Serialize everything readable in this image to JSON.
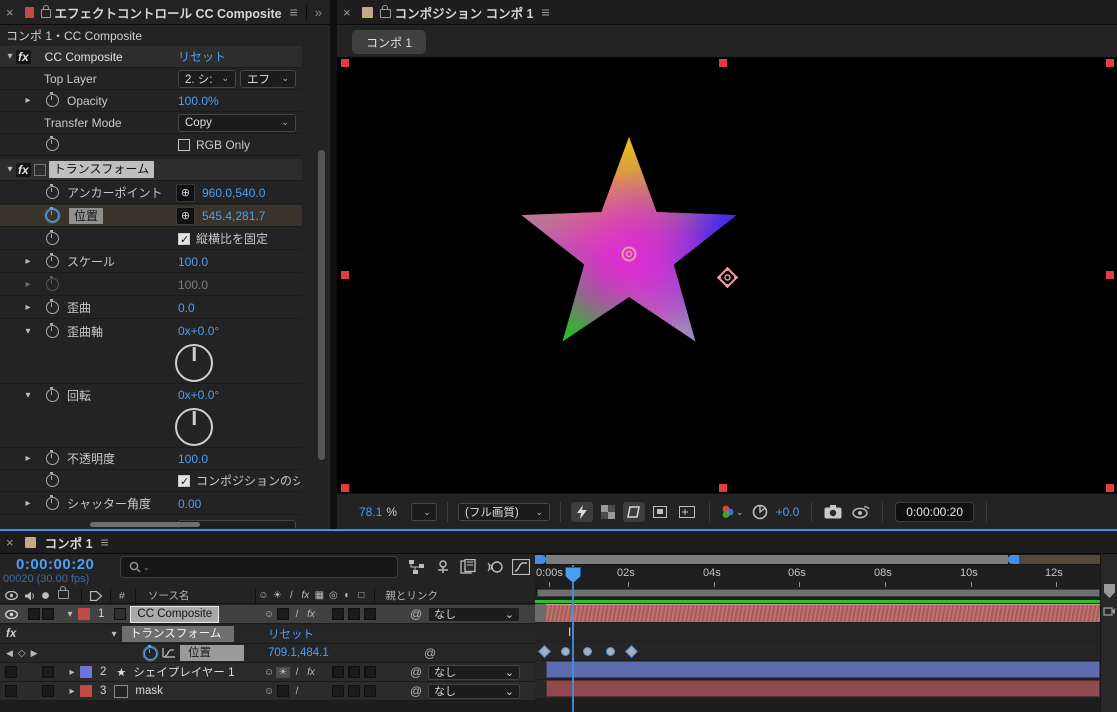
{
  "colors": {
    "accent_blue": "#4f9ef5",
    "tab_red": "#c14a44",
    "tab_tan": "#c2ab84",
    "label_red": "#c14a44",
    "label_blue": "#6e74d8",
    "bar_selected_red": "#bc6a66",
    "bar_blue": "#5d6cae",
    "bar_dark_red": "#8e4a4d",
    "cache_green": "#24c424",
    "playhead_blue": "#3f8fe8"
  },
  "icons": {
    "close": "×",
    "menu": "≡",
    "overflow": "»",
    "chevron_down": "▾",
    "chevron_right": "▸",
    "caret": "⌄",
    "star": "★",
    "pickwhip": "@",
    "target": "⊕",
    "kf_prev": "◀",
    "kf_add": "◇",
    "kf_next": "▶",
    "fx": "fx",
    "shy": "☺",
    "collapse": "☀",
    "quality": "/",
    "frame_blend": "▦",
    "motion_blur": "◎",
    "adjustment": "◐",
    "threed": "□",
    "hash": "#",
    "ibeam": "I"
  },
  "effect_controls": {
    "title": "エフェクトコントロール CC Composite",
    "breadcrumb": "コンポ 1・CC Composite",
    "reset": "リセット",
    "cc": {
      "name": "CC Composite",
      "top_layer_label": "Top Layer",
      "top_layer_value": "2. シ:",
      "top_layer_mode": "エフ",
      "opacity_label": "Opacity",
      "opacity_value": "100.0%",
      "transfer_label": "Transfer Mode",
      "transfer_value": "Copy",
      "rgb_only_label": "RGB Only"
    },
    "tr": {
      "name": "トランスフォーム",
      "anchor_label": "アンカーポイント",
      "anchor_value": "960.0,540.0",
      "position_label": "位置",
      "position_value": "545.4,281.7",
      "aspect_label": "縦横比を固定",
      "scale_label": "スケール",
      "scale_value": "100.0",
      "scale2_value": "100.0",
      "skew_label": "歪曲",
      "skew_value": "0.0",
      "skew_axis_label": "歪曲軸",
      "skew_axis_value": "0x+0.0°",
      "rotation_label": "回転",
      "rotation_value": "0x+0.0°",
      "opacity_label": "不透明度",
      "opacity_value": "100.0",
      "comp_shutter_label": "コンポジションのシャッ",
      "shutter_label": "シャッター角度",
      "shutter_value": "0.00"
    }
  },
  "viewer": {
    "title": "コンポジション コンポ 1",
    "tab": "コンポ 1",
    "zoom_value": "78.1",
    "zoom_unit": "%",
    "quality": "(フル画質)",
    "exposure": "+0.0",
    "timecode": "0:00:00:20"
  },
  "timeline": {
    "tab": "コンポ 1",
    "timecode": "0:00:00:20",
    "frame_info": "00020 (30.00 fps)",
    "columns": {
      "source_name": "ソース名",
      "parent": "親とリンク"
    },
    "fx_row": {
      "name": "トランスフォーム",
      "reset": "リセット"
    },
    "pos_row": {
      "name": "位置",
      "value": "709.1,484.1"
    },
    "layers": [
      {
        "num": "1",
        "name": "CC Composite",
        "parent": "なし"
      },
      {
        "num": "2",
        "name": "シェイプレイヤー 1",
        "parent": "なし"
      },
      {
        "num": "3",
        "name": "mask",
        "parent": "なし"
      }
    ],
    "ruler": [
      "0:00s",
      "02s",
      "04s",
      "06s",
      "08s",
      "10s",
      "12s"
    ]
  }
}
